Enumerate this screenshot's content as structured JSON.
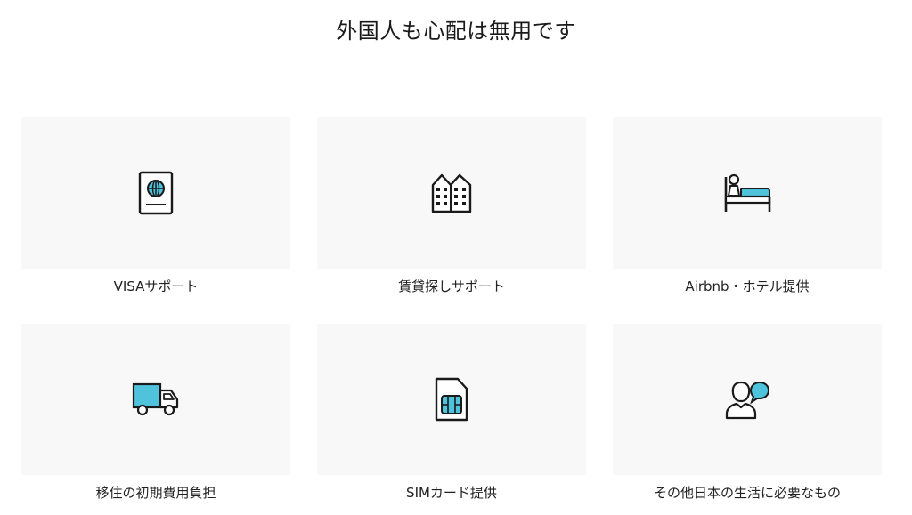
{
  "page_title": "外国人も心配は無用です",
  "colors": {
    "card_background": "#f8f8f8",
    "accent": "#4fc3dc",
    "icon_stroke": "#1a1a1a"
  },
  "services": [
    {
      "label": "VISAサポート",
      "icon": "passport-icon"
    },
    {
      "label": "賃貸探しサポート",
      "icon": "buildings-icon"
    },
    {
      "label": "Airbnb・ホテル提供",
      "icon": "bed-icon"
    },
    {
      "label": "移住の初期費用負担",
      "icon": "truck-icon"
    },
    {
      "label": "SIMカード提供",
      "icon": "sim-card-icon"
    },
    {
      "label": "その他日本の生活に必要なもの",
      "icon": "person-speech-icon"
    }
  ]
}
